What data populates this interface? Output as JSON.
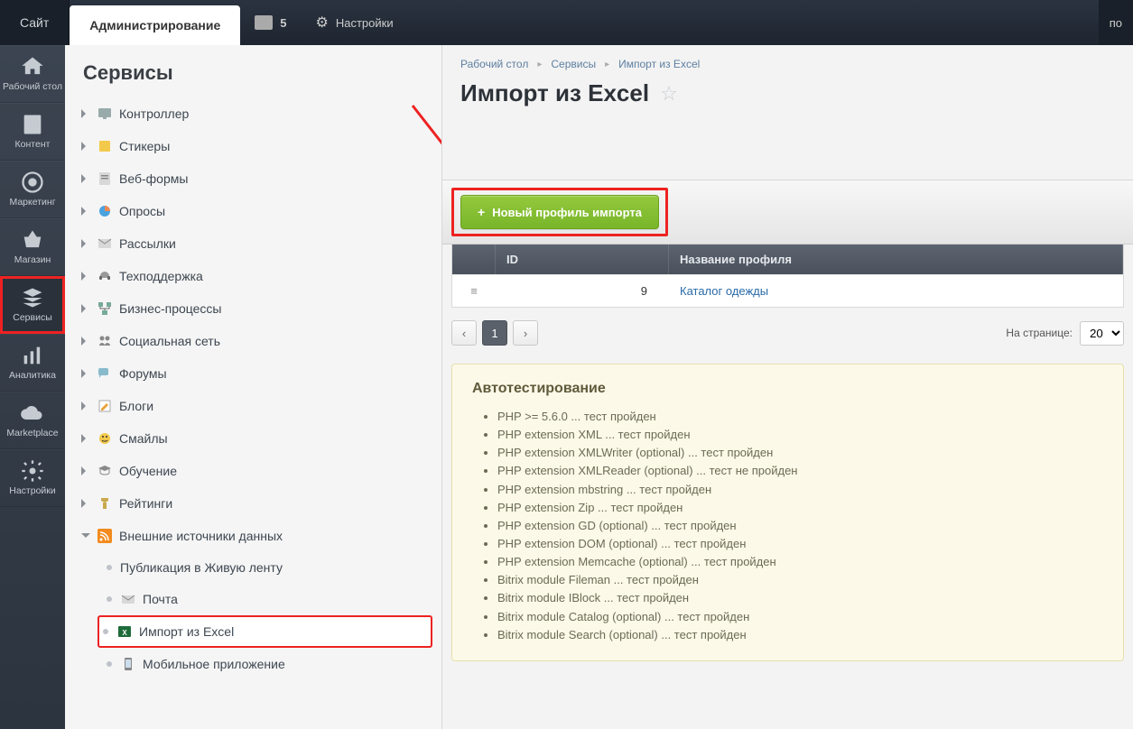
{
  "topbar": {
    "site": "Сайт",
    "admin": "Администрирование",
    "notif_count": "5",
    "settings": "Настройки",
    "right": "по"
  },
  "rail": [
    {
      "key": "desktop",
      "label": "Рабочий стол"
    },
    {
      "key": "content",
      "label": "Контент"
    },
    {
      "key": "marketing",
      "label": "Маркетинг"
    },
    {
      "key": "shop",
      "label": "Магазин"
    },
    {
      "key": "services",
      "label": "Сервисы"
    },
    {
      "key": "analytics",
      "label": "Аналитика"
    },
    {
      "key": "marketplace",
      "label": "Marketplace"
    },
    {
      "key": "settings",
      "label": "Настройки"
    }
  ],
  "sidebar": {
    "title": "Сервисы",
    "items": [
      {
        "label": "Контроллер",
        "icon": "controller"
      },
      {
        "label": "Стикеры",
        "icon": "sticker"
      },
      {
        "label": "Веб-формы",
        "icon": "forms"
      },
      {
        "label": "Опросы",
        "icon": "polls"
      },
      {
        "label": "Рассылки",
        "icon": "mail"
      },
      {
        "label": "Техподдержка",
        "icon": "support"
      },
      {
        "label": "Бизнес-процессы",
        "icon": "bizproc"
      },
      {
        "label": "Социальная сеть",
        "icon": "social"
      },
      {
        "label": "Форумы",
        "icon": "forums"
      },
      {
        "label": "Блоги",
        "icon": "blogs"
      },
      {
        "label": "Смайлы",
        "icon": "smiles"
      },
      {
        "label": "Обучение",
        "icon": "learning"
      },
      {
        "label": "Рейтинги",
        "icon": "rating"
      }
    ],
    "external": {
      "group_label": "Внешние источники данных",
      "children": [
        {
          "label": "Публикация в Живую ленту"
        },
        {
          "label": "Почта"
        },
        {
          "label": "Импорт из Excel",
          "hl": true
        },
        {
          "label": "Мобильное приложение"
        }
      ]
    }
  },
  "breadcrumb": [
    "Рабочий стол",
    "Сервисы",
    "Импорт из Excel"
  ],
  "page_title": "Импорт из Excel",
  "toolbar": {
    "new_profile": "Новый профиль импорта"
  },
  "table": {
    "cols": {
      "id": "ID",
      "name": "Название профиля"
    },
    "rows": [
      {
        "id": "9",
        "name": "Каталог одежды"
      }
    ]
  },
  "pager": {
    "page": "1",
    "perpage_label": "На странице:",
    "perpage_value": "20"
  },
  "autotest": {
    "title": "Автотестирование",
    "items": [
      "PHP >= 5.6.0 ... тест пройден",
      "PHP extension XML ... тест пройден",
      "PHP extension XMLWriter (optional) ... тест пройден",
      "PHP extension XMLReader (optional) ... тест не пройден",
      "PHP extension mbstring ... тест пройден",
      "PHP extension Zip ... тест пройден",
      "PHP extension GD (optional) ... тест пройден",
      "PHP extension DOM (optional) ... тест пройден",
      "PHP extension Memcache (optional) ... тест пройден",
      "Bitrix module Fileman ... тест пройден",
      "Bitrix module IBlock ... тест пройден",
      "Bitrix module Catalog (optional) ... тест пройден",
      "Bitrix module Search (optional) ... тест пройден"
    ]
  }
}
